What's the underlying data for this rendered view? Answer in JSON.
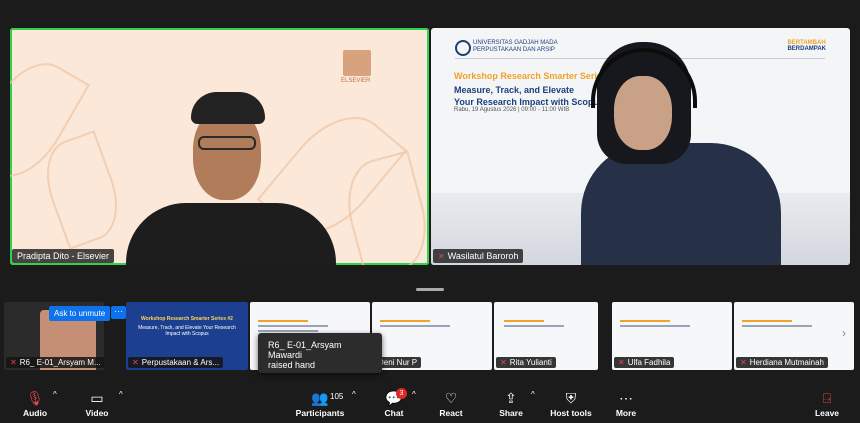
{
  "main_tiles": {
    "left": {
      "name": "Pradipta Dito - Elsevier",
      "logo_text": "ELSEVIER"
    },
    "right": {
      "name": "Wasilatul Baroroh",
      "slide": {
        "university": "UNIVERSITAS GADJAH MADA",
        "department": "PERPUSTAKAAN DAN ARSIP",
        "brand_top": "BERTAMBAH",
        "brand_bottom": "BERDAMPAK",
        "kicker": "Workshop Research Smarter Series",
        "title_line1": "Measure, Track, and Elevate",
        "title_line2": "Your Research Impact with Scopus",
        "date": "Rabu, 19 Agustus 2026 | 09:00 - 11:00 WIB"
      }
    }
  },
  "strip": {
    "ask_to_unmute": "Ask to unmute",
    "more": "···",
    "tiles": [
      "R6_ E-01_Arsyam M...",
      "Perpustakaan & Ars...",
      "",
      "Deni Nur P",
      "Rita Yulianti",
      "Ulfa Fadhila",
      "Herdiana Mutmainah"
    ],
    "thumb_slide_title": "Workshop Research Smarter Series #2",
    "thumb_slide_subtitle": "Measure, Track, and Elevate Your Research Impact with Scopus",
    "tooltip_line1": "R6_ E-01_Arsyam Mawardi",
    "tooltip_line2": "raised hand"
  },
  "toolbar": {
    "audio": "Audio",
    "video": "Video",
    "participants": "Participants",
    "participants_count": "105",
    "chat": "Chat",
    "chat_badge": "3",
    "react": "React",
    "share": "Share",
    "host_tools": "Host tools",
    "more": "More",
    "leave": "Leave"
  },
  "colors": {
    "accent": "#0e72ed",
    "active_speaker": "#2fd14d",
    "danger": "#e24646"
  }
}
